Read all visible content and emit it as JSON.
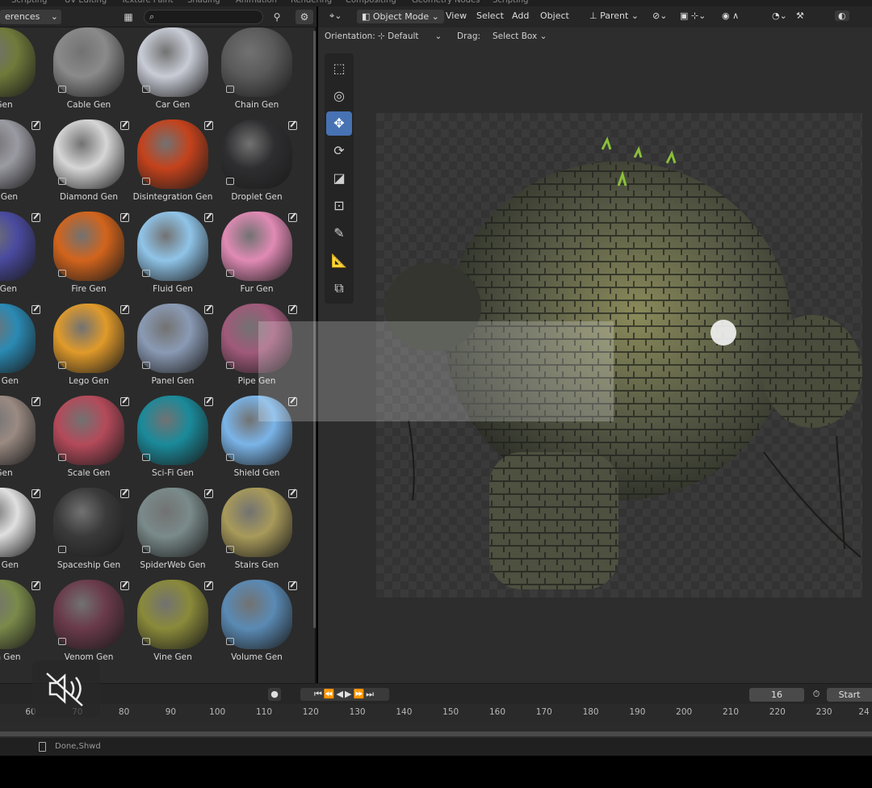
{
  "workspace_tabs": [
    "Scripting",
    "UV Editing",
    "Texture Paint",
    "Shading",
    "Animation",
    "Rendering",
    "Compositing",
    "Geometry Nodes",
    "Scripting"
  ],
  "asset_browser": {
    "library_dropdown": "erences",
    "search_placeholder": "",
    "assets": [
      {
        "label": "h Gen",
        "color": "#6f7a3a"
      },
      {
        "label": "Cable Gen",
        "color": "#8a8a8a"
      },
      {
        "label": "Car Gen",
        "color": "#c8ccd6"
      },
      {
        "label": "Chain Gen",
        "color": "#5a5a5a"
      },
      {
        "label": "age Gen",
        "color": "#9a9aa2"
      },
      {
        "label": "Diamond Gen",
        "color": "#d6d6d6"
      },
      {
        "label": "Disintegration Gen",
        "color": "#c4421c"
      },
      {
        "label": "Droplet Gen",
        "color": "#2e2e30"
      },
      {
        "label": "ner Gen",
        "color": "#4a4aa0"
      },
      {
        "label": "Fire Gen",
        "color": "#d2641c"
      },
      {
        "label": "Fluid Gen",
        "color": "#8fc4e8"
      },
      {
        "label": "Fur Gen",
        "color": "#e08ab4"
      },
      {
        "label": "oike Gen",
        "color": "#2a8ab4"
      },
      {
        "label": "Lego Gen",
        "color": "#e09a2a"
      },
      {
        "label": "Panel Gen",
        "color": "#8a9ab4"
      },
      {
        "label": "Pipe Gen",
        "color": "#a05a7a"
      },
      {
        "label": "d Gen",
        "color": "#9a8a82"
      },
      {
        "label": "Scale Gen",
        "color": "#b44a5a"
      },
      {
        "label": "Sci-Fi Gen",
        "color": "#1a8a9a"
      },
      {
        "label": "Shield Gen",
        "color": "#7ab4e8"
      },
      {
        "label": "lake Gen",
        "color": "#e0e0e0"
      },
      {
        "label": "Spaceship Gen",
        "color": "#3a3a3a"
      },
      {
        "label": "SpiderWeb Gen",
        "color": "#7a8a8a"
      },
      {
        "label": "Stairs Gen",
        "color": "#a89a5a"
      },
      {
        "label": "ation Gen",
        "color": "#7a8a4a"
      },
      {
        "label": "Venom Gen",
        "color": "#6a3a4a"
      },
      {
        "label": "Vine Gen",
        "color": "#8a8a3a"
      },
      {
        "label": "Volume Gen",
        "color": "#5a8ab4"
      }
    ]
  },
  "viewport": {
    "editor_type_icon": "viewport-icon",
    "mode": "Object Mode",
    "menus": [
      "View",
      "Select",
      "Add",
      "Object"
    ],
    "pivot": "Parent",
    "orientation_label": "Orientation:",
    "orientation_value": "Default",
    "drag_label": "Drag:",
    "drag_value": "Select Box",
    "accent_color": "#4772b3"
  },
  "timeline": {
    "current_frame": "16",
    "start_label": "Start",
    "ticks": [
      "60",
      "70",
      "80",
      "90",
      "100",
      "110",
      "120",
      "130",
      "140",
      "150",
      "160",
      "170",
      "180",
      "190",
      "200",
      "210",
      "220",
      "230",
      "24"
    ]
  },
  "status": {
    "text": "Done,Shwd"
  }
}
